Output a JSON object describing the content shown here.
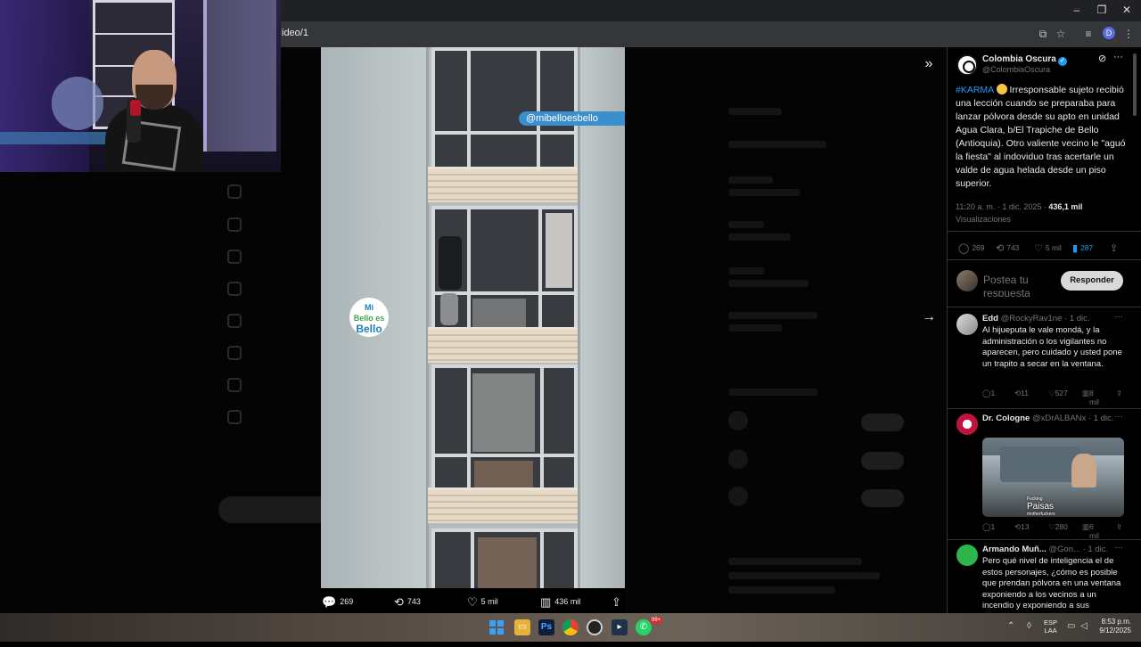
{
  "browser": {
    "url_fragment": "ideo/1",
    "window_controls": [
      "–",
      "❐",
      "✕"
    ],
    "profile_initial": "D"
  },
  "video": {
    "watermark": "@mibelloesbello",
    "logo_lines": [
      "Mi",
      "Bello",
      "es",
      "Bello"
    ],
    "stats": {
      "replies": "269",
      "reposts": "743",
      "likes": "5 mil",
      "views": "436 mil"
    }
  },
  "tweet": {
    "author_name": "Colombia Oscura",
    "author_handle": "@ColombiaOscura",
    "hashtag": "#KARMA",
    "body": " Irresponsable sujeto recibió una lección cuando se preparaba para lanzar pólvora desde su apto en unidad Agua Clara, b/El Trapiche de Bello (Antioquia). Otro valiente vecino le \"aguó la fiesta\" al indoviduo tras acertarle un valde de agua helada desde un piso superior.",
    "timestamp": "11:20 a. m. · 1 dic. 2025 · ",
    "views_count": "436,1 mil",
    "views_label": "Visualizaciones",
    "actions": {
      "replies": "269",
      "reposts": "743",
      "likes": "5 mil",
      "bookmarks": "287"
    }
  },
  "compose": {
    "placeholder": "Postea tu respuesta",
    "reply_button": "Responder"
  },
  "replies": [
    {
      "name": "Edd",
      "handle": "@RockyRav1ne · 1 dic.",
      "text": "Al hijueputa le vale mondá, y la administración o los vigilantes no aparecen, pero cuidado y usted pone un trapito a secar en la ventana.",
      "replies": "1",
      "reposts": "11",
      "likes": "527",
      "views": "8 mil"
    },
    {
      "name": "Dr. Cologne",
      "handle": "@xDrALBANx · 1 dic.",
      "media_caption": "Paisas",
      "media_small": "Fucking",
      "media_small2": "motherfuckers",
      "replies": "1",
      "reposts": "13",
      "likes": "280",
      "views": "6 mil"
    },
    {
      "name": "Armando Muñ...",
      "handle": "@Gon... · 1 dic.",
      "text": "Pero qué nivel de inteligencia el de estos personajes, ¿cómo es posible que prendan pólvora en una ventana exponiendo a los vecinos a un incendio y exponiendo a sus"
    }
  ],
  "taskbar": {
    "badge": "99+",
    "lang_top": "ESP",
    "lang_bottom": "LAA",
    "time": "8:53 p.m.",
    "date": "9/12/2025"
  },
  "colors": {
    "accent": "#1d9bf0",
    "bookmark": "#1d9bf0",
    "background": "#000000"
  }
}
